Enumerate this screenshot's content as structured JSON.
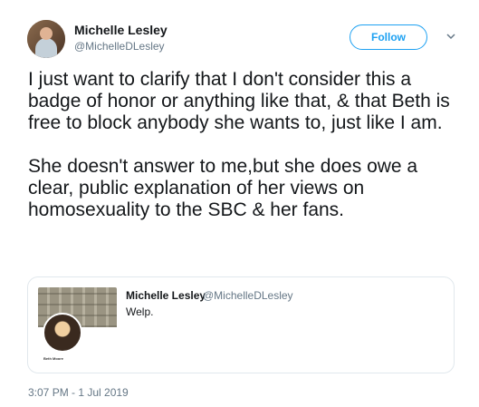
{
  "author": {
    "name": "Michelle Lesley",
    "handle": "@MichelleDLesley"
  },
  "follow_button": {
    "label": "Follow"
  },
  "tweet": {
    "text": "I just want to clarify that I don't consider this a badge of honor or anything like that, & that Beth is free to block anybody she wants to, just like I am.\n\nShe doesn't answer to me,but she does owe a clear, public explanation of her views on homosexuality to the SBC & her fans."
  },
  "quoted_tweet": {
    "name": "Michelle Lesley",
    "handle": "@MichelleDLesley",
    "text": "Welp.",
    "image_label": "Beth Moore"
  },
  "timestamp": "3:07 PM - 1 Jul 2019",
  "colors": {
    "accent": "#1da1f2",
    "secondary_text": "#657786",
    "border": "#e1e8ed"
  },
  "icons": {
    "menu": "chevron-down-icon"
  }
}
